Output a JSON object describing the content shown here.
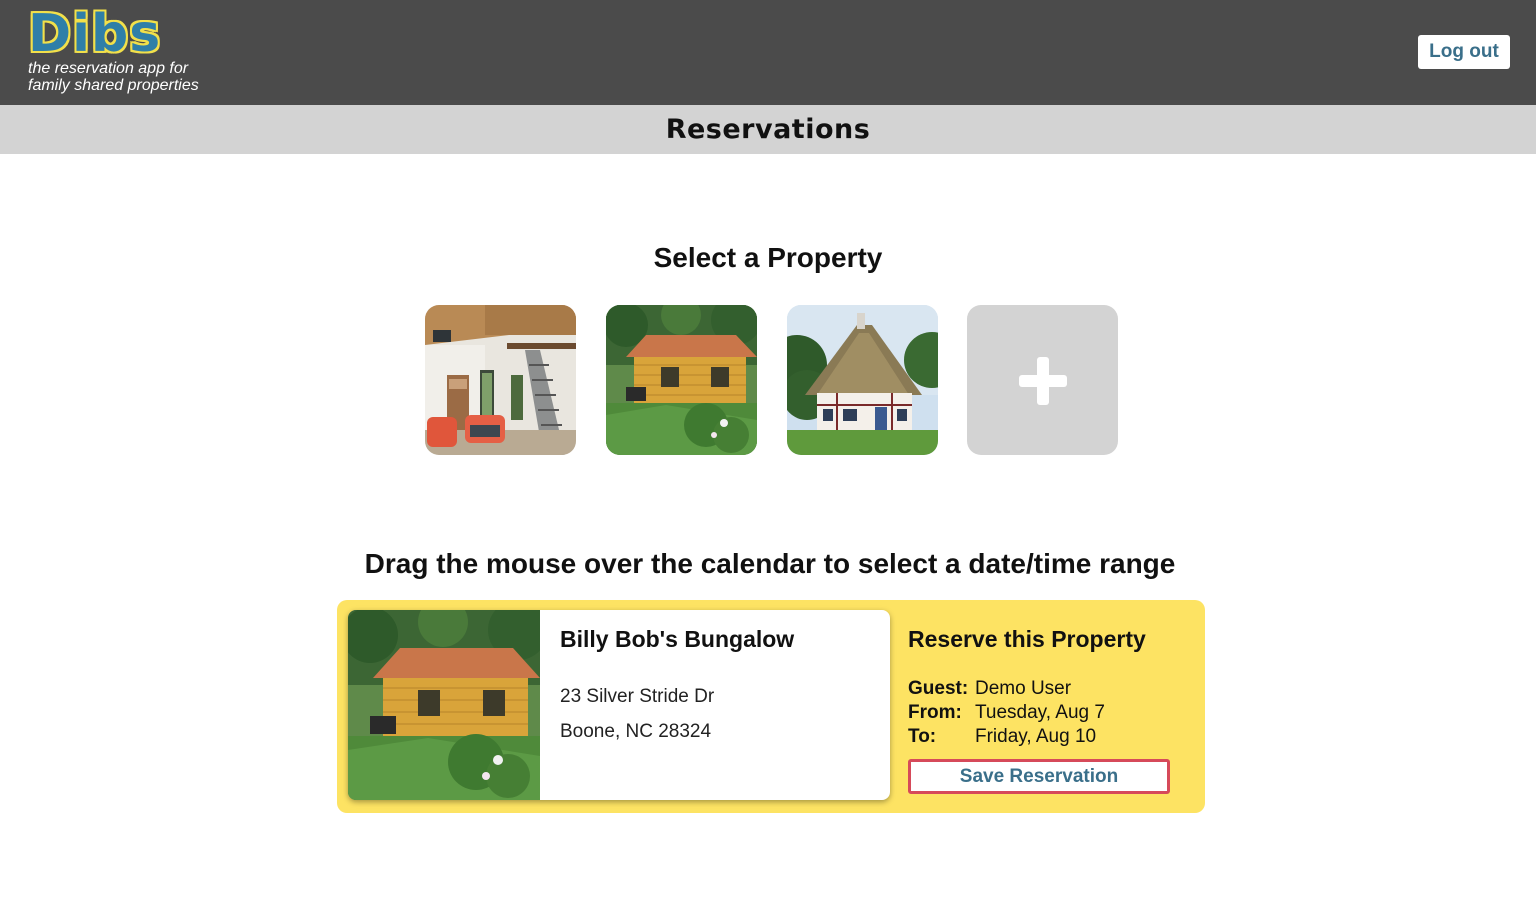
{
  "header": {
    "logo_text": "Dibs",
    "tagline_line1": "the reservation app for",
    "tagline_line2": "family shared properties",
    "logout_label": "Log out",
    "page_title": "Reservations"
  },
  "select_section": {
    "heading": "Select a Property",
    "thumbnails": [
      {
        "icon": "interior-loft-photo"
      },
      {
        "icon": "log-cabin-photo"
      },
      {
        "icon": "thatched-cottage-photo"
      },
      {
        "icon": "plus-icon"
      }
    ]
  },
  "instruction": "Drag the mouse over the calendar to select a date/time range",
  "property_card": {
    "name": "Billy Bob's Bungalow",
    "address_line1": "23 Silver Stride Dr",
    "address_line2": "Boone, NC 28324"
  },
  "reservation": {
    "title": "Reserve this Property",
    "guest_label": "Guest:",
    "guest_value": "Demo User",
    "from_label": "From:",
    "from_value": "Tuesday, Aug 7",
    "to_label": "To:",
    "to_value": "Friday, Aug 10",
    "save_label": "Save Reservation"
  },
  "colors": {
    "topbar": "#4b4b4b",
    "subbar": "#d3d3d3",
    "panel": "#fde363",
    "logo_blue": "#2f7fa8",
    "logo_yellow": "#f2e04a",
    "button_text": "#3a6f8a",
    "save_border": "#d64a5a"
  }
}
